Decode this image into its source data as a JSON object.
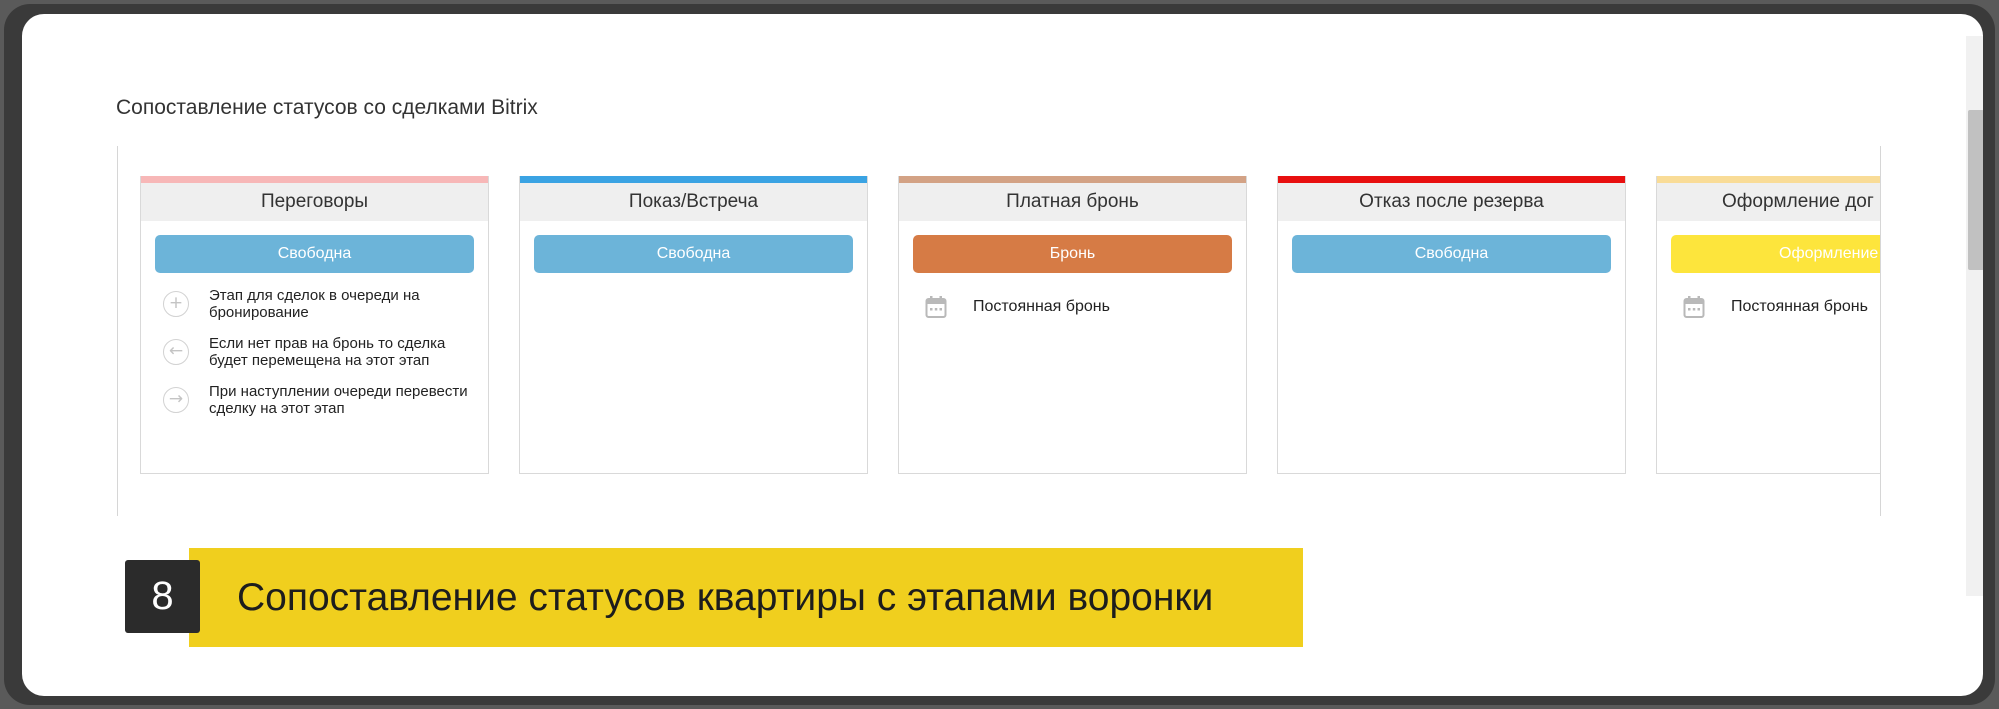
{
  "section_title": "Сопоставление статусов со сделками Bitrix",
  "columns": [
    {
      "title": "Переговоры",
      "bar_color": "#f7b7b7",
      "status": "Свободна",
      "status_color": "#6cb4d9",
      "options": [
        {
          "icon": "plus-circle-icon",
          "glyph": "+",
          "text": "Этап для сделок в очереди на бронирование"
        },
        {
          "icon": "arrow-left-circle-icon",
          "glyph": "←",
          "text": "Если нет прав на бронь то сделка будет перемещена на этот этап"
        },
        {
          "icon": "arrow-right-circle-icon",
          "glyph": "→",
          "text": "При наступлении очереди перевести сделку на этот этап"
        }
      ]
    },
    {
      "title": "Показ/Встреча",
      "bar_color": "#3aa3e3",
      "status": "Свободна",
      "status_color": "#6cb4d9"
    },
    {
      "title": "Платная бронь",
      "bar_color": "#d3a285",
      "status": "Бронь",
      "status_color": "#d67b45",
      "note": "Постоянная бронь",
      "note_icon": "calendar-icon"
    },
    {
      "title": "Отказ после резерва",
      "bar_color": "#e80f0f",
      "status": "Свободна",
      "status_color": "#6cb4d9"
    },
    {
      "title": "Оформление дог",
      "bar_color": "#f9dc97",
      "status": "Оформление",
      "status_color": "#fde53c",
      "note": "Постоянная бронь",
      "note_icon": "calendar-icon"
    }
  ],
  "caption": {
    "number": "8",
    "text": "Сопоставление статусов квартиры с этапами воронки"
  }
}
